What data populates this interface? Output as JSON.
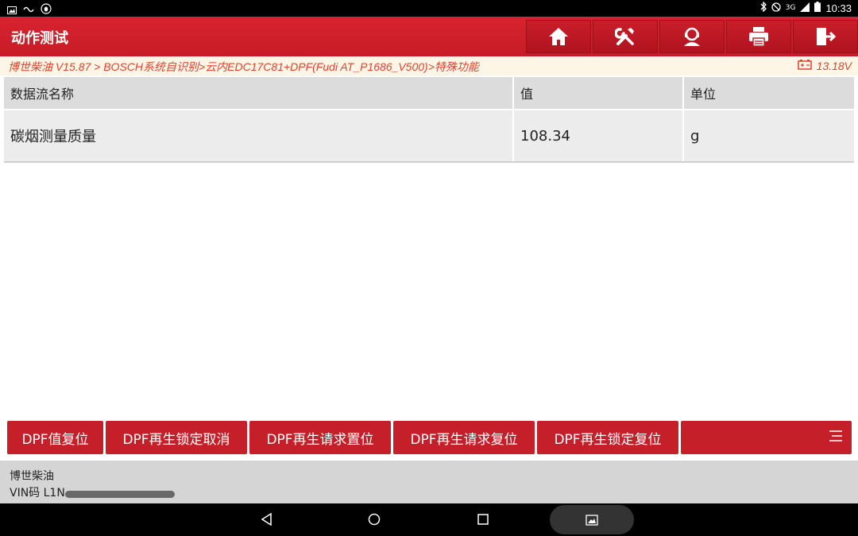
{
  "status_bar": {
    "time": "10:33",
    "network": "3G"
  },
  "app_bar": {
    "title": "动作测试",
    "tools": [
      {
        "icon": "home-icon"
      },
      {
        "icon": "tools-icon"
      },
      {
        "icon": "support-icon"
      },
      {
        "icon": "print-icon"
      },
      {
        "icon": "exit-icon"
      }
    ]
  },
  "breadcrumb": {
    "path": "博世柴油 V15.87 > BOSCH系统自识别>云内EDC17C81+DPF(Fudi AT_P1686_V500)>特殊功能",
    "voltage": "13.18V"
  },
  "table": {
    "headers": [
      "数据流名称",
      "值",
      "单位"
    ],
    "rows": [
      {
        "name": "碳烟测量质量",
        "value": "108.34",
        "unit": "g"
      }
    ]
  },
  "actions": [
    "DPF值复位",
    "DPF再生锁定取消",
    "DPF再生请求置位",
    "DPF再生请求复位",
    "DPF再生锁定复位"
  ],
  "info": {
    "line1": "博世柴油",
    "line2": "VIN码 L1N"
  },
  "colors": {
    "accent": "#c51f2a",
    "breadcrumb_text": "#e2402d"
  }
}
